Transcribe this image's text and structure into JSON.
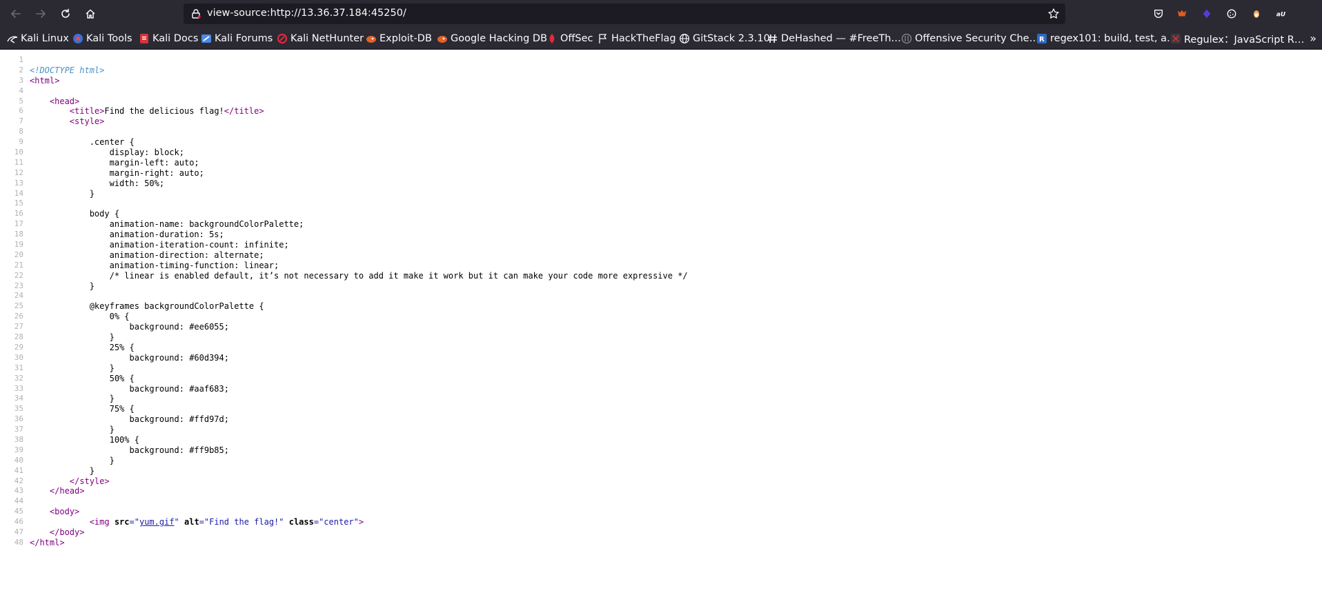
{
  "browser": {
    "url": "view-source:http://13.36.37.184:45250/",
    "bookmarks": [
      {
        "label": "Kali Linux",
        "icon": "kali-dragon-icon"
      },
      {
        "label": "Kali Tools",
        "icon": "kali-tools-icon"
      },
      {
        "label": "Kali Docs",
        "icon": "kali-docs-icon"
      },
      {
        "label": "Kali Forums",
        "icon": "kali-forums-icon"
      },
      {
        "label": "Kali NetHunter",
        "icon": "nethunter-icon"
      },
      {
        "label": "Exploit-DB",
        "icon": "exploit-db-icon"
      },
      {
        "label": "Google Hacking DB",
        "icon": "ghdb-icon"
      },
      {
        "label": "OffSec",
        "icon": "offsec-icon"
      },
      {
        "label": "HackTheFlag",
        "icon": "flag-icon"
      },
      {
        "label": "GitStack 2.3.10",
        "icon": "globe-icon"
      },
      {
        "label": "DeHashed — #FreeTh…",
        "icon": "hash-icon"
      },
      {
        "label": "Offensive Security Che…",
        "icon": "cheatsheet-icon"
      },
      {
        "label": "regex101: build, test, a…",
        "icon": "regex101-icon"
      },
      {
        "label": "Regulex：JavaScript R…",
        "icon": "regulex-icon"
      }
    ]
  },
  "source_lines": [
    {
      "n": "1",
      "parts": []
    },
    {
      "n": "2",
      "parts": [
        {
          "t": "<!DOCTYPE html>",
          "c": "doctype"
        }
      ]
    },
    {
      "n": "3",
      "parts": [
        {
          "t": "<html>",
          "c": "tag"
        }
      ]
    },
    {
      "n": "4",
      "parts": []
    },
    {
      "n": "5",
      "parts": [
        {
          "t": "    "
        },
        {
          "t": "<head>",
          "c": "tag"
        }
      ]
    },
    {
      "n": "6",
      "parts": [
        {
          "t": "        "
        },
        {
          "t": "<title>",
          "c": "tag"
        },
        {
          "t": "Find the delicious flag!"
        },
        {
          "t": "</title>",
          "c": "tag"
        }
      ]
    },
    {
      "n": "7",
      "parts": [
        {
          "t": "        "
        },
        {
          "t": "<style>",
          "c": "tag"
        }
      ]
    },
    {
      "n": "8",
      "parts": []
    },
    {
      "n": "9",
      "parts": [
        {
          "t": "            .center {"
        }
      ]
    },
    {
      "n": "10",
      "parts": [
        {
          "t": "                display: block;"
        }
      ]
    },
    {
      "n": "11",
      "parts": [
        {
          "t": "                margin-left: auto;"
        }
      ]
    },
    {
      "n": "12",
      "parts": [
        {
          "t": "                margin-right: auto;"
        }
      ]
    },
    {
      "n": "13",
      "parts": [
        {
          "t": "                width: 50%;"
        }
      ]
    },
    {
      "n": "14",
      "parts": [
        {
          "t": "            }"
        }
      ]
    },
    {
      "n": "15",
      "parts": []
    },
    {
      "n": "16",
      "parts": [
        {
          "t": "            body {"
        }
      ]
    },
    {
      "n": "17",
      "parts": [
        {
          "t": "                animation-name: backgroundColorPalette;"
        }
      ]
    },
    {
      "n": "18",
      "parts": [
        {
          "t": "                animation-duration: 5s;"
        }
      ]
    },
    {
      "n": "19",
      "parts": [
        {
          "t": "                animation-iteration-count: infinite;"
        }
      ]
    },
    {
      "n": "20",
      "parts": [
        {
          "t": "                animation-direction: alternate;"
        }
      ]
    },
    {
      "n": "21",
      "parts": [
        {
          "t": "                animation-timing-function: linear;"
        }
      ]
    },
    {
      "n": "22",
      "parts": [
        {
          "t": "                /* linear is enabled default, it’s not necessary to add it make it work but it can make your code more expressive */"
        }
      ]
    },
    {
      "n": "23",
      "parts": [
        {
          "t": "            }"
        }
      ]
    },
    {
      "n": "24",
      "parts": []
    },
    {
      "n": "25",
      "parts": [
        {
          "t": "            @keyframes backgroundColorPalette {"
        }
      ]
    },
    {
      "n": "26",
      "parts": [
        {
          "t": "                0% {"
        }
      ]
    },
    {
      "n": "27",
      "parts": [
        {
          "t": "                    background: #ee6055;"
        }
      ]
    },
    {
      "n": "28",
      "parts": [
        {
          "t": "                }"
        }
      ]
    },
    {
      "n": "29",
      "parts": [
        {
          "t": "                25% {"
        }
      ]
    },
    {
      "n": "30",
      "parts": [
        {
          "t": "                    background: #60d394;"
        }
      ]
    },
    {
      "n": "31",
      "parts": [
        {
          "t": "                }"
        }
      ]
    },
    {
      "n": "32",
      "parts": [
        {
          "t": "                50% {"
        }
      ]
    },
    {
      "n": "33",
      "parts": [
        {
          "t": "                    background: #aaf683;"
        }
      ]
    },
    {
      "n": "34",
      "parts": [
        {
          "t": "                }"
        }
      ]
    },
    {
      "n": "35",
      "parts": [
        {
          "t": "                75% {"
        }
      ]
    },
    {
      "n": "36",
      "parts": [
        {
          "t": "                    background: #ffd97d;"
        }
      ]
    },
    {
      "n": "37",
      "parts": [
        {
          "t": "                }"
        }
      ]
    },
    {
      "n": "38",
      "parts": [
        {
          "t": "                100% {"
        }
      ]
    },
    {
      "n": "39",
      "parts": [
        {
          "t": "                    background: #ff9b85;"
        }
      ]
    },
    {
      "n": "40",
      "parts": [
        {
          "t": "                }"
        }
      ]
    },
    {
      "n": "41",
      "parts": [
        {
          "t": "            }"
        }
      ]
    },
    {
      "n": "42",
      "parts": [
        {
          "t": "        "
        },
        {
          "t": "</style>",
          "c": "tag"
        }
      ]
    },
    {
      "n": "43",
      "parts": [
        {
          "t": "    "
        },
        {
          "t": "</head>",
          "c": "tag"
        }
      ]
    },
    {
      "n": "44",
      "parts": []
    },
    {
      "n": "45",
      "parts": [
        {
          "t": "    "
        },
        {
          "t": "<body>",
          "c": "tag"
        }
      ]
    },
    {
      "n": "46",
      "parts": [
        {
          "t": "            "
        },
        {
          "t": "<img ",
          "c": "tag"
        },
        {
          "t": "src",
          "c": "attr"
        },
        {
          "t": "=\"",
          "c": "val"
        },
        {
          "t": "yum.gif",
          "c": "link"
        },
        {
          "t": "\" ",
          "c": "val"
        },
        {
          "t": "alt",
          "c": "attr"
        },
        {
          "t": "=\"Find the flag!\" ",
          "c": "val"
        },
        {
          "t": "class",
          "c": "attr"
        },
        {
          "t": "=\"center\"",
          "c": "val"
        },
        {
          "t": ">",
          "c": "tag"
        }
      ]
    },
    {
      "n": "47",
      "parts": [
        {
          "t": "    "
        },
        {
          "t": "</body>",
          "c": "tag"
        }
      ]
    },
    {
      "n": "48",
      "parts": [
        {
          "t": "</html>",
          "c": "tag"
        }
      ]
    }
  ]
}
